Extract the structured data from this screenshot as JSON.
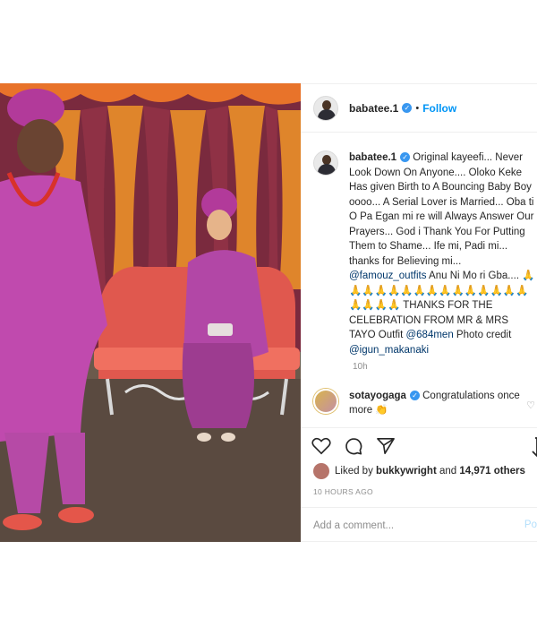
{
  "post": {
    "username": "babatee.1",
    "follow_label": "Follow",
    "separator": "•",
    "caption_text": "Original kayeefi... Never Look Down On Anyone.... Oloko Keke Has given Birth to A Bouncing Baby Boy oooo... A Serial Lover is Married... Oba ti O Pa Egan mi re will Always Answer Our Prayers... God i Thank You For Putting Them to Shame... Ife mi, Padi mi... thanks for Believing mi...",
    "caption_mention1": "@famouz_outfits",
    "caption_mid": "Anu Ni Mo ri Gba....",
    "caption_emojis": "🙏🙏🙏🙏🙏🙏🙏🙏🙏🙏🙏🙏🙏🙏🙏🙏🙏🙏🙏",
    "caption_tail": "THANKS FOR THE CELEBRATION FROM MR & MRS TAYO Outfit",
    "caption_mention2": "@684men",
    "caption_photo_credit": "Photo credit",
    "caption_mention3": "@igun_makanaki",
    "caption_time": "10h"
  },
  "comment": {
    "username": "sotayogaga",
    "text": "Congratulations once more 👏"
  },
  "likes": {
    "prefix": "Liked by",
    "user": "bukkywright",
    "joiner": "and",
    "count": "14,971 others"
  },
  "timestamp": "10 HOURS AGO",
  "add_comment_placeholder": "Add a comment...",
  "post_button": "Po",
  "colors": {
    "accent": "#0095f6",
    "verified": "#3897f0",
    "outfit": "#b247a6"
  }
}
